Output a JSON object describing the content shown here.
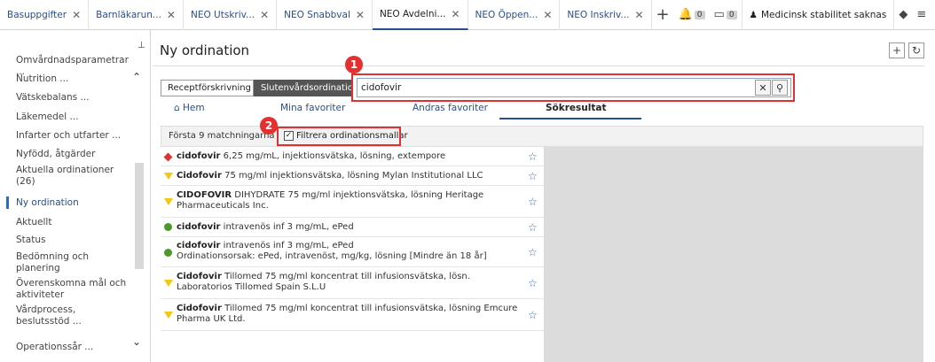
{
  "tabs": [
    {
      "label": "Basuppgifter",
      "active": false
    },
    {
      "label": "Barnläkarun...",
      "active": false
    },
    {
      "label": "NEO Utskriv...",
      "active": false
    },
    {
      "label": "NEO Snabbval",
      "active": false
    },
    {
      "label": "NEO Avdelni...",
      "active": true
    },
    {
      "label": "NEO Öppen...",
      "active": false
    },
    {
      "label": "NEO Inskriv...",
      "active": false
    }
  ],
  "toolbar": {
    "add_label": "+",
    "badge_one": "0",
    "badge_two": "0",
    "patient_warning": "Medicinsk stabilitet saknas"
  },
  "sidebar": {
    "items": [
      "Omvårdnadsparametrar ...",
      "Nutrition ...",
      "Vätskebalans ...",
      "Läkemedel ...",
      "Infarter och utfarter ...",
      "Nyfödd, åtgärder",
      "Aktuella ordinationer (26)",
      "Ny ordination",
      "Aktuellt",
      "Status",
      "Bedömning och planering",
      "Överenskomna mål och aktiviteter",
      "Vårdprocess, beslutsstöd ...",
      "Operationssår ..."
    ]
  },
  "main": {
    "title": "Ny ordination",
    "seg_off": "Receptförskrivning",
    "seg_on": "Slutenvårdsordination",
    "search_value": "cidofovir",
    "nav": [
      "Hem",
      "Mina favoriter",
      "Andras favoriter",
      "Sökresultat"
    ],
    "filter_text": "Första 9 matchningarna",
    "filter_checkbox": "Filtrera ordinationsmallar",
    "annotation_1": "1",
    "annotation_2": "2"
  },
  "results": [
    {
      "name": "cidofovir",
      "rest": " 6,25 mg/mL, injektionsvätska, lösning, extempore",
      "indicator": "diamond"
    },
    {
      "name": "Cidofovir",
      "rest": " 75 mg/ml injektionsvätska, lösning Mylan Institutional LLC",
      "indicator": "triangle"
    },
    {
      "name": "CIDOFOVIR",
      "rest": " DIHYDRATE 75 mg/ml injektionsvätska, lösning Heritage Pharmaceuticals Inc.",
      "indicator": "triangle"
    },
    {
      "name": "cidofovir",
      "rest": " intravenös inf 3 mg/mL, ePed",
      "indicator": "circle"
    },
    {
      "name": "cidofovir",
      "rest": " intravenös inf 3 mg/mL, ePed",
      "line2": "Ordinationsorsak: ePed, intravenöst, mg/kg, lösning [Mindre än 18 år]",
      "indicator": "circle"
    },
    {
      "name": "Cidofovir",
      "rest": " Tillomed 75 mg/ml koncentrat till infusionsvätska, lösn. Laboratorios Tillomed Spain S.L.U",
      "indicator": "triangle"
    },
    {
      "name": "Cidofovir",
      "rest": " Tillomed 75 mg/ml koncentrat till infusionsvätska, lösning Emcure Pharma UK Ltd.",
      "indicator": "triangle"
    }
  ],
  "colors": {
    "accent": "#2a4f8a",
    "annotation": "#e03030",
    "selected_segment": "#555555"
  }
}
